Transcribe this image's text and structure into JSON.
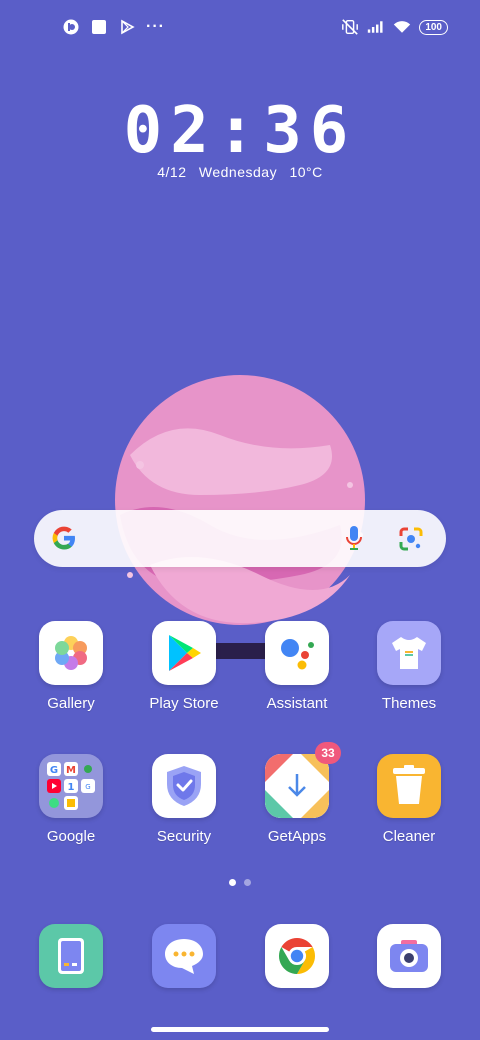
{
  "status_bar": {
    "icons_left": [
      "music-app-icon",
      "square-notification-icon",
      "play-outline-icon",
      "more-dots-icon"
    ],
    "icons_right": [
      "vibrate-off-icon",
      "signal-icon",
      "wifi-icon"
    ],
    "battery": "100",
    "more": "···"
  },
  "clock": {
    "time": "02:36",
    "date": "4/12",
    "weekday": "Wednesday",
    "temperature": "10°C"
  },
  "search_bar": {
    "icons": [
      "google-g-icon",
      "mic-icon",
      "google-lens-icon"
    ]
  },
  "apps_row1": [
    {
      "label": "Gallery",
      "icon": "gallery-icon"
    },
    {
      "label": "Play Store",
      "icon": "play-store-icon"
    },
    {
      "label": "Assistant",
      "icon": "assistant-icon"
    },
    {
      "label": "Themes",
      "icon": "themes-icon"
    }
  ],
  "apps_row2": [
    {
      "label": "Google",
      "icon": "google-folder-icon"
    },
    {
      "label": "Security",
      "icon": "security-icon"
    },
    {
      "label": "GetApps",
      "icon": "getapps-icon",
      "badge": "33"
    },
    {
      "label": "Cleaner",
      "icon": "cleaner-icon"
    }
  ],
  "page_indicator": {
    "pages": 2,
    "current": 1
  },
  "dock": [
    {
      "icon": "phone-icon"
    },
    {
      "icon": "messaging-icon"
    },
    {
      "icon": "chrome-icon"
    },
    {
      "icon": "camera-icon"
    }
  ],
  "colors": {
    "background": "#5a5ec8",
    "themes_icon": "#a6a7f8",
    "cleaner_icon": "#f9b531",
    "phone_icon": "#5cc8a8",
    "messaging_icon": "#7d86f0",
    "badge": "#f0587c"
  }
}
